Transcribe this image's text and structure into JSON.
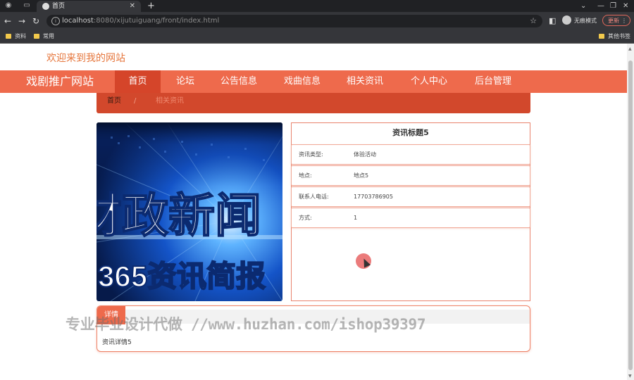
{
  "browser": {
    "tab_title": "首页",
    "new_tab": "+",
    "url_host": "localhost",
    "url_rest": ":8080/xijutuiguang/front/index.html",
    "incognito_label": "无痕模式",
    "update_label": "更新",
    "bookmarks": [
      "资料",
      "常用"
    ],
    "other_bookmarks": "其他书签"
  },
  "site": {
    "welcome": "欢迎来到我的网站",
    "title": "戏剧推广网站"
  },
  "nav": {
    "items": [
      {
        "label": "首页",
        "active": true
      },
      {
        "label": "论坛"
      },
      {
        "label": "公告信息"
      },
      {
        "label": "戏曲信息"
      },
      {
        "label": "相关资讯"
      },
      {
        "label": "个人中心"
      },
      {
        "label": "后台管理"
      }
    ]
  },
  "breadcrumb": {
    "home": "首页",
    "separator": "/",
    "current": "相关资讯"
  },
  "news_image": {
    "line1": "财政新闻",
    "line2": "365资讯简报"
  },
  "detail": {
    "title": "资讯标题5",
    "rows": [
      {
        "label": "资讯类型:",
        "value": "体验活动"
      },
      {
        "label": "地点:",
        "value": "地点5"
      },
      {
        "label": "联系人电话:",
        "value": "17703786905"
      },
      {
        "label": "方式:",
        "value": "1"
      }
    ],
    "tab_label": "详情",
    "content": "资讯详情5"
  },
  "watermark": "专业毕业设计代做 //www.huzhan.com/ishop39397",
  "colors": {
    "accent": "#ee6a4c",
    "accent_dark": "#d2482c",
    "welcome": "#e6763c"
  }
}
